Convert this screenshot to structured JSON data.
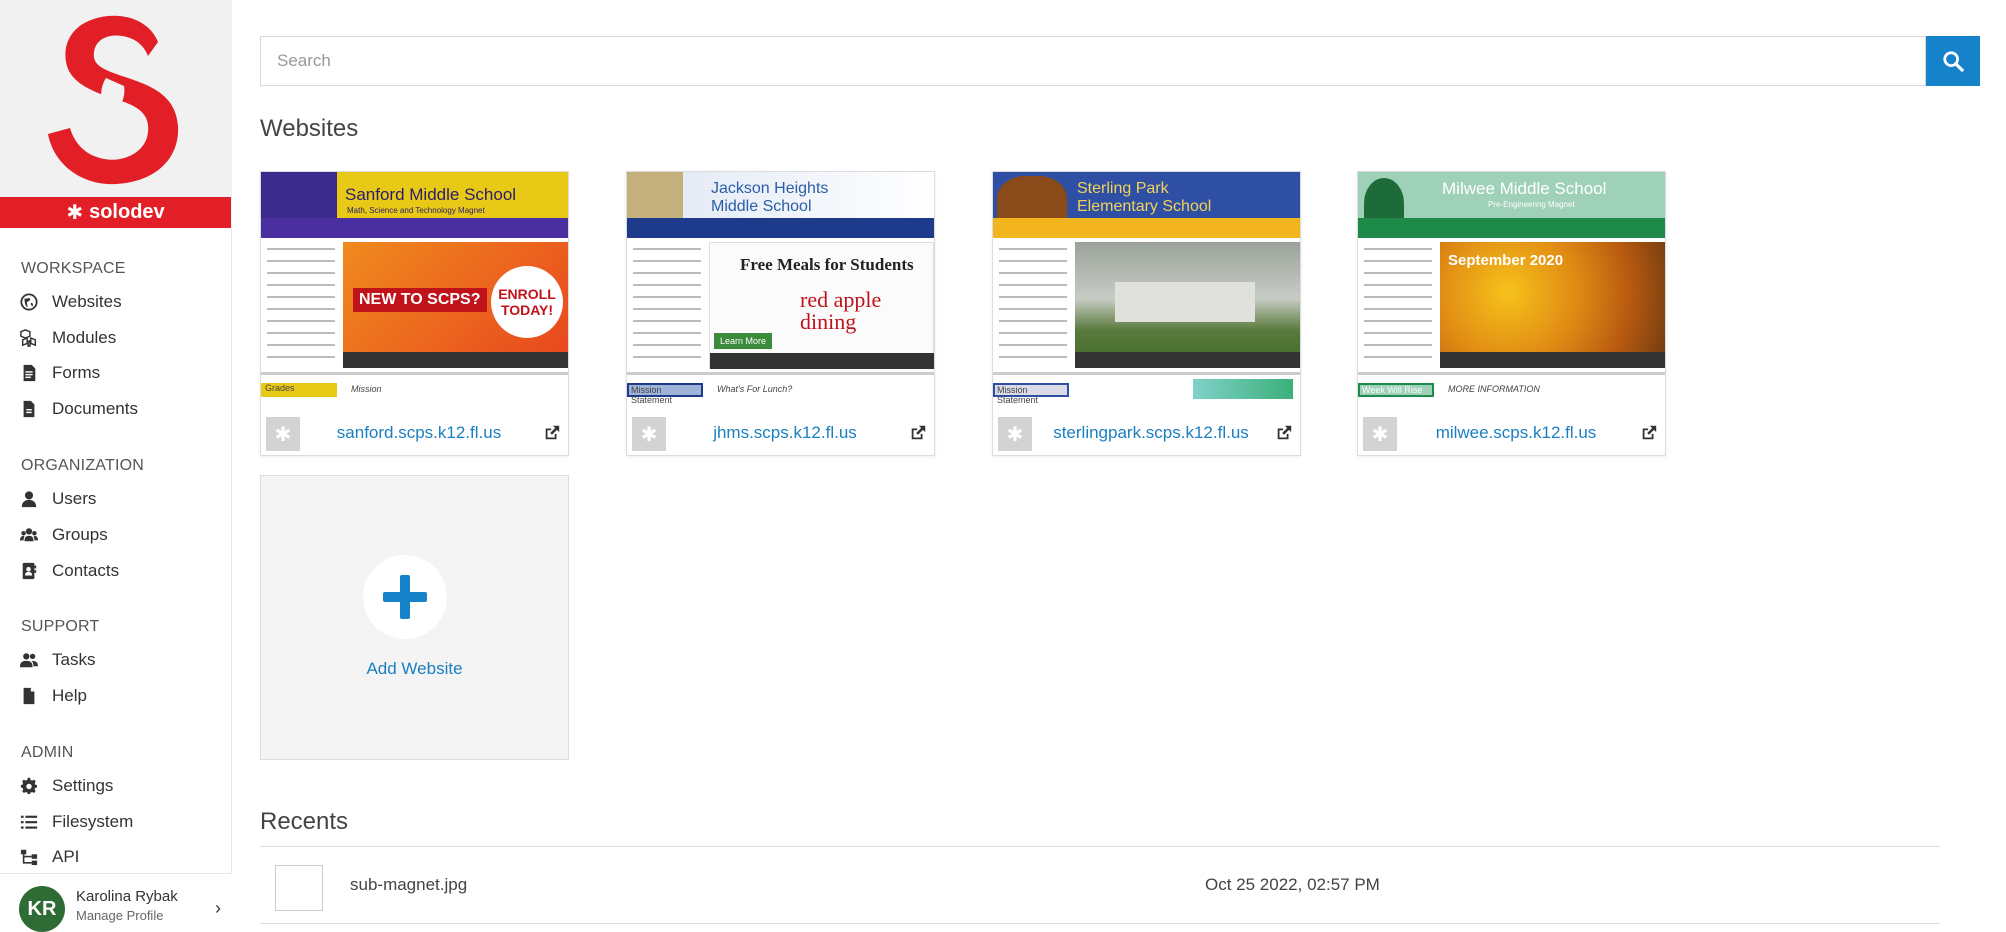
{
  "brand": {
    "name": "solodev",
    "accent": "#e21f26",
    "link_color": "#1a7fc1",
    "button_color": "#1582c9"
  },
  "sidebar": {
    "sections": [
      {
        "title": "WORKSPACE",
        "items": [
          {
            "label": "Websites",
            "icon": "globe-icon"
          },
          {
            "label": "Modules",
            "icon": "cubes-icon"
          },
          {
            "label": "Forms",
            "icon": "form-icon"
          },
          {
            "label": "Documents",
            "icon": "document-icon"
          }
        ]
      },
      {
        "title": "ORGANIZATION",
        "items": [
          {
            "label": "Users",
            "icon": "user-icon"
          },
          {
            "label": "Groups",
            "icon": "users-icon"
          },
          {
            "label": "Contacts",
            "icon": "contact-book-icon"
          }
        ]
      },
      {
        "title": "SUPPORT",
        "items": [
          {
            "label": "Tasks",
            "icon": "tasks-icon"
          },
          {
            "label": "Help",
            "icon": "help-file-icon"
          }
        ]
      },
      {
        "title": "ADMIN",
        "items": [
          {
            "label": "Settings",
            "icon": "gear-icon"
          },
          {
            "label": "Filesystem",
            "icon": "list-icon"
          },
          {
            "label": "API",
            "icon": "sitemap-icon"
          }
        ]
      }
    ],
    "profile": {
      "initials": "KR",
      "name": "Karolina Rybak",
      "subtitle": "Manage Profile"
    }
  },
  "search": {
    "placeholder": "Search"
  },
  "websites": {
    "title": "Websites",
    "items": [
      {
        "domain": "sanford.scps.k12.fl.us",
        "thumb_title": "Sanford Middle School",
        "thumb_subtitle": "Math, Science and Technology Magnet",
        "hero_text_1": "NEW TO SCPS?",
        "hero_text_2": "ENROLL TODAY!",
        "bottom_left": "Grades",
        "bottom_right": "Mission"
      },
      {
        "domain": "jhms.scps.k12.fl.us",
        "thumb_title": "Jackson Heights Middle School",
        "thumb_subtitle": "",
        "hero_text_1": "Free Meals for Students",
        "hero_text_2": "red apple dining",
        "bottom_left": "Mission Statement",
        "bottom_right": "What's For Lunch?"
      },
      {
        "domain": "sterlingpark.scps.k12.fl.us",
        "thumb_title": "Sterling Park Elementary School",
        "thumb_subtitle": "",
        "hero_text_1": "",
        "hero_text_2": "",
        "bottom_left": "Mission Statement",
        "bottom_right": ""
      },
      {
        "domain": "milwee.scps.k12.fl.us",
        "thumb_title": "Milwee Middle School",
        "thumb_subtitle": "Pre-Engineering Magnet",
        "hero_text_1": "September 2020",
        "hero_text_2": "",
        "bottom_left": "Week Will Rise",
        "bottom_right": "MORE INFORMATION"
      }
    ],
    "add_label": "Add Website"
  },
  "recents": {
    "title": "Recents",
    "items": [
      {
        "name": "sub-magnet.jpg",
        "date": "Oct 25 2022, 02:57 PM"
      }
    ]
  }
}
